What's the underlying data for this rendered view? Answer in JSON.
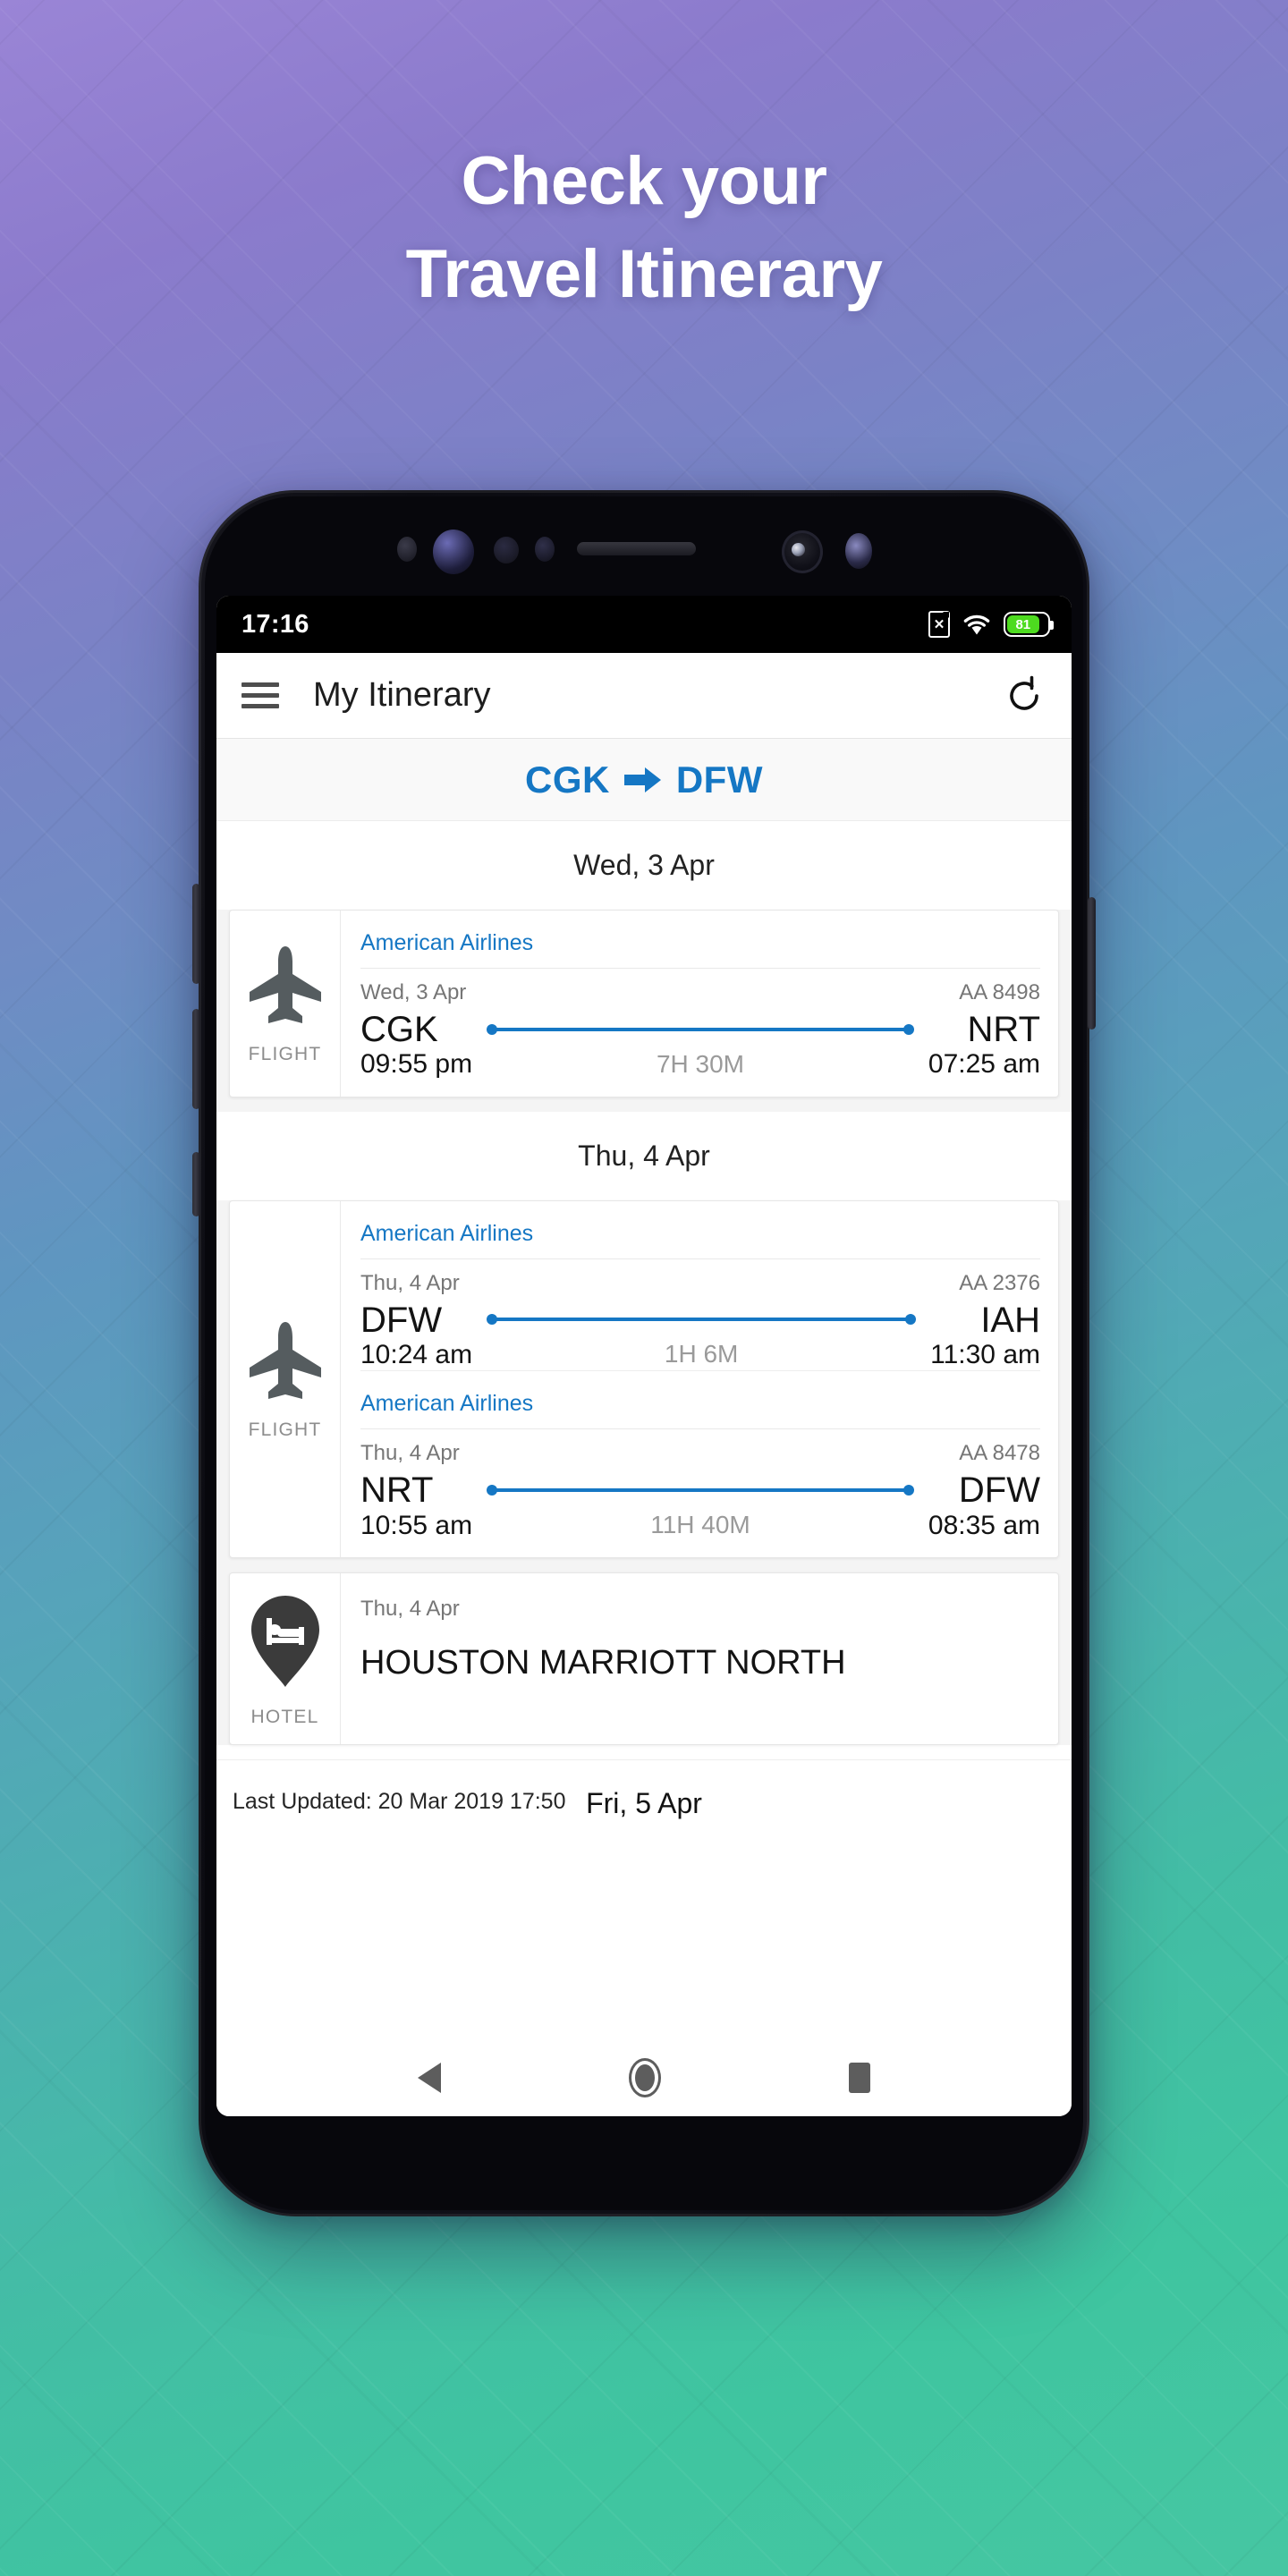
{
  "promo": {
    "headline_line1": "Check your",
    "headline_line2": "Travel Itinerary"
  },
  "status_bar": {
    "time": "17:16",
    "sim_icon_glyph": "✕",
    "wifi_icon": "wifi-icon",
    "battery_percent": "81"
  },
  "app_bar": {
    "menu_icon": "hamburger-menu-icon",
    "title": "My Itinerary",
    "refresh_icon": "refresh-icon"
  },
  "route": {
    "origin": "CGK",
    "arrow": "➔",
    "destination": "DFW"
  },
  "days": [
    {
      "label": "Wed, 3 Apr",
      "cards": [
        {
          "kind": "flight",
          "icon_label": "FLIGHT",
          "segments": [
            {
              "airline": "American Airlines",
              "date": "Wed, 3 Apr",
              "flight_no": "AA 8498",
              "from_code": "CGK",
              "from_time": "09:55 pm",
              "duration": "7H 30M",
              "to_code": "NRT",
              "to_time": "07:25 am"
            }
          ]
        }
      ]
    },
    {
      "label": "Thu, 4 Apr",
      "cards": [
        {
          "kind": "flight",
          "icon_label": "FLIGHT",
          "segments": [
            {
              "airline": "American Airlines",
              "date": "Thu, 4 Apr",
              "flight_no": "AA 2376",
              "from_code": "DFW",
              "from_time": "10:24 am",
              "duration": "1H 6M",
              "to_code": "IAH",
              "to_time": "11:30 am"
            },
            {
              "airline": "American Airlines",
              "date": "Thu, 4 Apr",
              "flight_no": "AA 8478",
              "from_code": "NRT",
              "from_time": "10:55 am",
              "duration": "11H 40M",
              "to_code": "DFW",
              "to_time": "08:35 am"
            }
          ]
        },
        {
          "kind": "hotel",
          "icon_label": "HOTEL",
          "date": "Thu, 4 Apr",
          "name": "HOUSTON MARRIOTT NORTH"
        }
      ]
    }
  ],
  "footer": {
    "last_updated": "Last Updated: 20 Mar 2019 17:50",
    "next_day_label": "Fri, 5 Apr"
  },
  "nav_bar": {
    "back": "back-nav-button",
    "home": "home-nav-button",
    "recents": "recents-nav-button"
  },
  "colors": {
    "accent_blue": "#1577c4",
    "battery_green": "#4ddb1f",
    "gradient_start": "#8b7bcc",
    "gradient_end": "#3fc5a0"
  }
}
